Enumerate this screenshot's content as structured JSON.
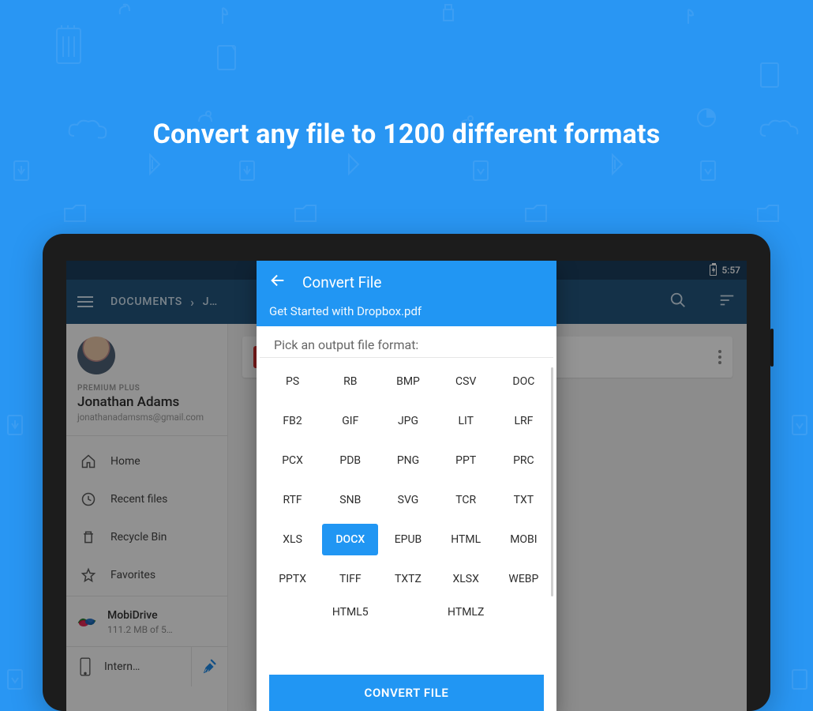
{
  "promo_headline": "Convert any file to 1200 different formats",
  "statusbar": {
    "time": "5:57"
  },
  "appbar": {
    "breadcrumb": {
      "root": "DOCUMENTS",
      "current": "J…"
    }
  },
  "sidebar": {
    "plan": "PREMIUM PLUS",
    "user_name": "Jonathan Adams",
    "user_email": "jonathanadamsms@gmail.com",
    "nav": {
      "home": "Home",
      "recent": "Recent files",
      "recycle": "Recycle Bin",
      "favorites": "Favorites"
    },
    "storage": {
      "mobidrive_title": "MobiDrive",
      "mobidrive_sub": "111.2 MB of 5…",
      "internal_title": "Intern…"
    }
  },
  "dialog": {
    "title": "Convert File",
    "filename": "Get Started with Dropbox.pdf",
    "picker_label": "Pick an output file format:",
    "selected": "DOCX",
    "button": "CONVERT FILE",
    "formats_full": [
      "PS",
      "RB",
      "BMP",
      "CSV",
      "DOC",
      "FB2",
      "GIF",
      "JPG",
      "LIT",
      "LRF",
      "PCX",
      "PDB",
      "PNG",
      "PPT",
      "PRC",
      "RTF",
      "SNB",
      "SVG",
      "TCR",
      "TXT",
      "XLS",
      "DOCX",
      "EPUB",
      "HTML",
      "MOBI",
      "PPTX",
      "TIFF",
      "TXTZ",
      "XLSX",
      "WEBP"
    ],
    "formats_partial": [
      "HTML5",
      "HTMLZ"
    ]
  }
}
